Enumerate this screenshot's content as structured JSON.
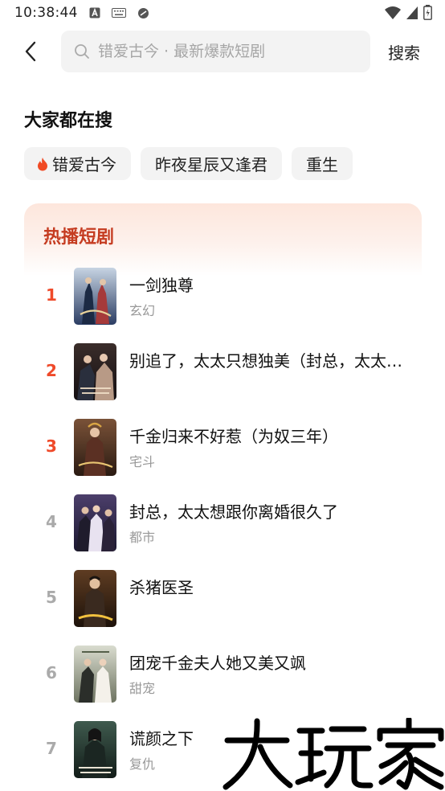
{
  "status_bar": {
    "time": "10:38:44"
  },
  "search": {
    "placeholder": "错爱古今 · 最新爆款短剧",
    "search_button": "搜索"
  },
  "hot_searches": {
    "title": "大家都在搜",
    "chips": [
      "错爱古今",
      "昨夜星辰又逢君",
      "重生"
    ]
  },
  "hot_dramas": {
    "title": "热播短剧",
    "items": [
      {
        "rank": "1",
        "title": "一剑独尊",
        "tag": "玄幻"
      },
      {
        "rank": "2",
        "title": "别追了，太太只想独美（封总，太太想跟你离婚很久了）",
        "tag": ""
      },
      {
        "rank": "3",
        "title": "千金归来不好惹（为奴三年）",
        "tag": "宅斗"
      },
      {
        "rank": "4",
        "title": "封总，太太想跟你离婚很久了",
        "tag": "都市"
      },
      {
        "rank": "5",
        "title": "杀猪医圣",
        "tag": ""
      },
      {
        "rank": "6",
        "title": "团宠千金夫人她又美又飒",
        "tag": "甜宠"
      },
      {
        "rank": "7",
        "title": "谎颜之下",
        "tag": "复仇"
      }
    ]
  },
  "watermark": {
    "text": "大玩家"
  },
  "colors": {
    "accent": "#ef4a2a",
    "hot_title": "#c53c21",
    "chip_bg": "#f3f3f3"
  }
}
